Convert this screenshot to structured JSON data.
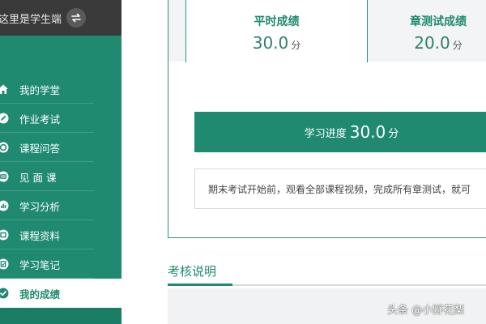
{
  "header": {
    "role_text": "这里是学生端",
    "switch_icon": "swap-icon"
  },
  "sidebar": {
    "items": [
      {
        "label": "我的学堂",
        "icon": "home-icon",
        "active": false
      },
      {
        "label": "作业考试",
        "icon": "pencil-icon",
        "active": false
      },
      {
        "label": "课程问答",
        "icon": "chat-icon",
        "active": false
      },
      {
        "label": "见 面 课",
        "icon": "meeting-icon",
        "active": false
      },
      {
        "label": "学习分析",
        "icon": "chart-icon",
        "active": false
      },
      {
        "label": "课程资料",
        "icon": "folder-icon",
        "active": false
      },
      {
        "label": "学习笔记",
        "icon": "note-icon",
        "active": false
      },
      {
        "label": "我的成绩",
        "icon": "check-icon",
        "active": true
      }
    ]
  },
  "tabs": [
    {
      "label": "平时成绩",
      "value": "30.0",
      "unit": "分"
    },
    {
      "label": "章测试成绩",
      "value": "20.0",
      "unit": "分"
    }
  ],
  "progress": {
    "label": "学习进度",
    "value": "30.0",
    "unit": "分"
  },
  "notice": {
    "text": "期末考试开始前，观看全部课程视频，完成所有章测试，就可"
  },
  "section": {
    "title": "考核说明"
  },
  "watermark": {
    "text": "头条 @小野花梨"
  },
  "colors": {
    "brand_green": "#1f8a70",
    "header_dark": "#3a3a3a",
    "tab_inactive_bg": "#f3f4f5"
  }
}
